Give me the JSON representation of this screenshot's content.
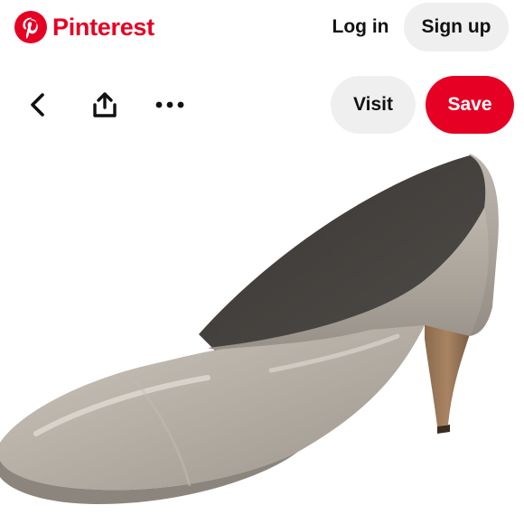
{
  "brand": {
    "name": "Pinterest",
    "color": "#e60023",
    "logo_icon": "pinterest-logo"
  },
  "header": {
    "login_label": "Log in",
    "signup_label": "Sign up"
  },
  "toolbar": {
    "back_icon": "chevron-left-icon",
    "share_icon": "share-icon",
    "more_icon": "ellipsis-icon",
    "visit_label": "Visit",
    "save_label": "Save"
  },
  "pin": {
    "image_subject": "taupe patent leather pointed-toe kitten heel pump"
  }
}
